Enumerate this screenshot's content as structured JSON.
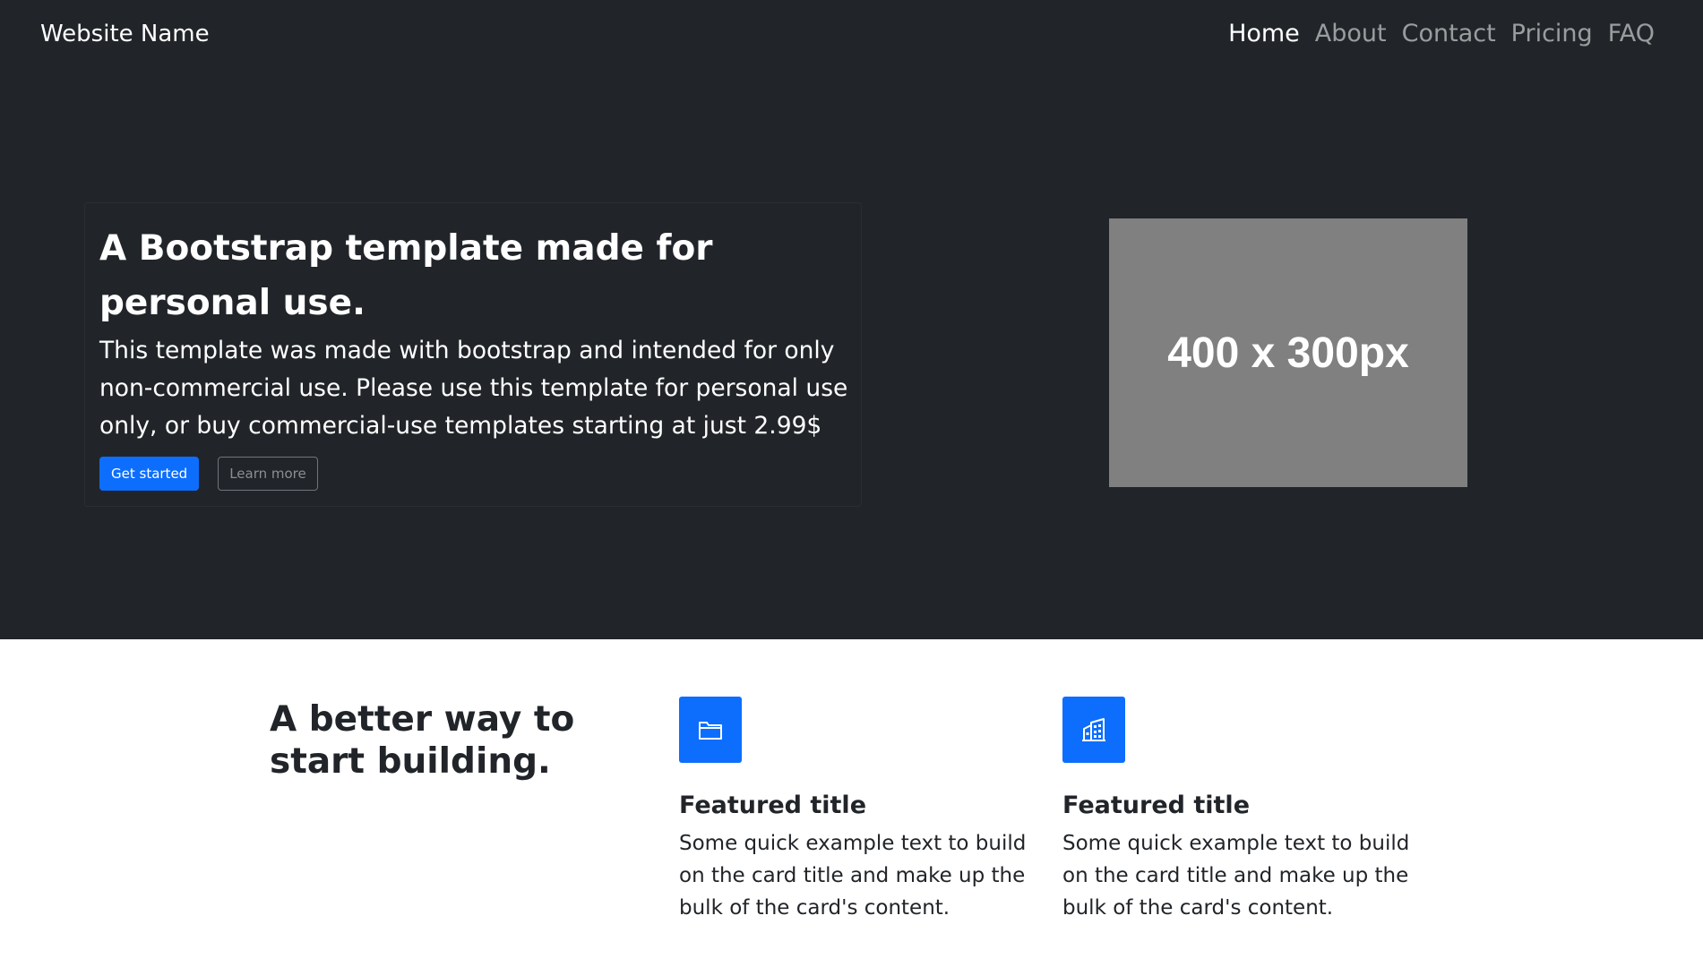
{
  "navbar": {
    "brand": "Website Name",
    "links": [
      {
        "label": "Home",
        "active": true
      },
      {
        "label": "About",
        "active": false
      },
      {
        "label": "Contact",
        "active": false
      },
      {
        "label": "Pricing",
        "active": false
      },
      {
        "label": "FAQ",
        "active": false
      }
    ]
  },
  "hero": {
    "title": "A Bootstrap template made for personal use.",
    "lead": "This template was made with bootstrap and intended for only non-commercial use. Please use this template for personal use only, or buy commercial-use templates starting at just 2.99$",
    "primary_button": "Get started",
    "secondary_button": "Learn more",
    "image_placeholder": "400 x 300px"
  },
  "features": {
    "heading": "A better way to start building.",
    "items": [
      {
        "icon": "folder-icon",
        "title": "Featured title",
        "text": "Some quick example text to build on the card title and make up the bulk of the card's content."
      },
      {
        "icon": "building-icon",
        "title": "Featured title",
        "text": "Some quick example text to build on the card title and make up the bulk of the card's content."
      }
    ]
  },
  "colors": {
    "dark_background": "#212529",
    "primary": "#0d6efd",
    "placeholder_gray": "#808080"
  }
}
